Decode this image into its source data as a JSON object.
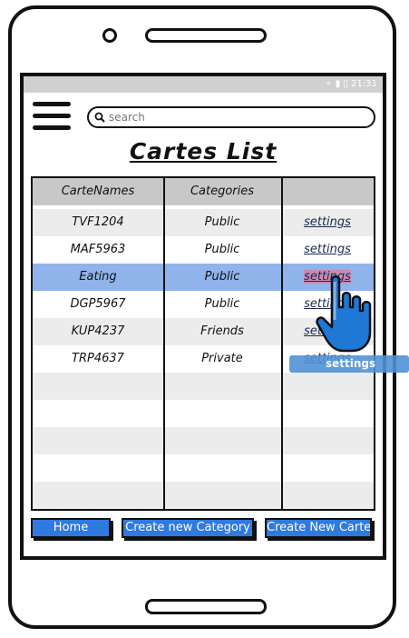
{
  "statusbar": {
    "time": "21:31"
  },
  "search": {
    "placeholder": "search"
  },
  "page": {
    "title": "Cartes List"
  },
  "table": {
    "headers": [
      "CarteNames",
      "Categories",
      ""
    ],
    "rows": [
      {
        "name": "TVF1204",
        "category": "Public",
        "action": "settings"
      },
      {
        "name": "MAF5963",
        "category": "Public",
        "action": "settings"
      },
      {
        "name": "Eating",
        "category": "Public",
        "action": "settings"
      },
      {
        "name": "DGP5967",
        "category": "Public",
        "action": "settings"
      },
      {
        "name": "KUP4237",
        "category": "Friends",
        "action": "settings"
      },
      {
        "name": "TRP4637",
        "category": "Private",
        "action": "settings"
      }
    ],
    "selected_row": 2
  },
  "buttons": {
    "home": "Home",
    "create_category": "Create new Category",
    "create_carte": "Create New Carte"
  },
  "tooltip": {
    "text": "settings"
  },
  "colors": {
    "accent": "#2f7ae0",
    "selected": "#8fb3ea",
    "tooltip": "#4f93d6"
  },
  "icons": {
    "menu": "hamburger-icon",
    "search": "search-icon",
    "pointer": "hand-pointer-icon"
  }
}
